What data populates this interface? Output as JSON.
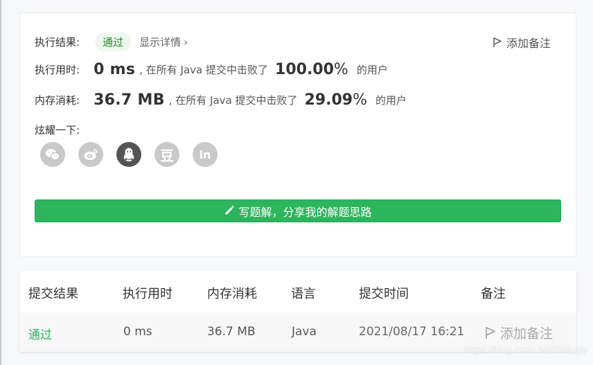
{
  "result": {
    "label": "执行结果:",
    "status": "通过",
    "details_link": "显示详情",
    "add_note": "添加备注"
  },
  "runtime": {
    "label": "执行用时:",
    "value": "0 ms",
    "beat_text": ", 在所有 Java 提交中击败了",
    "percent": "100.00",
    "percent_sym": "%",
    "tail": "的用户"
  },
  "memory": {
    "label": "内存消耗:",
    "value": "36.7 MB",
    "beat_text": ", 在所有 Java 提交中击败了",
    "percent": "29.09",
    "percent_sym": "%",
    "tail": "的用户"
  },
  "share": {
    "label": "炫耀一下:",
    "icons": [
      "wechat-icon",
      "weibo-icon",
      "qq-icon",
      "douban-icon",
      "linkedin-icon"
    ],
    "douban_glyph": "豆",
    "linkedin_glyph": "in"
  },
  "solution_button": "写题解，分享我的解题思路",
  "table": {
    "headers": [
      "提交结果",
      "执行用时",
      "内存消耗",
      "语言",
      "提交时间",
      "备注"
    ],
    "row": {
      "status": "通过",
      "runtime": "0 ms",
      "memory": "36.7 MB",
      "language": "Java",
      "time": "2021/08/17 16:21",
      "note": "添加备注"
    }
  },
  "watermark": "https://blog.csdn.net/Getugly",
  "colors": {
    "accent_green": "#2db55d",
    "badge_bg": "#eef7ec",
    "active_icon": "#555555",
    "inactive_icon": "#c9c9c9"
  }
}
